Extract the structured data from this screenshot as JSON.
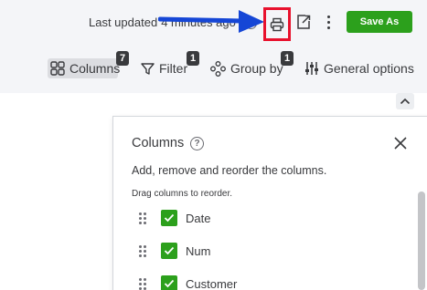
{
  "header": {
    "last_updated_label": "Last updated",
    "last_updated_ago": "4 minutes ago",
    "save_label": "Save As"
  },
  "toolbar": {
    "columns_label": "Columns",
    "columns_count": "7",
    "filter_label": "Filter",
    "filter_count": "1",
    "group_by_label": "Group by",
    "group_by_count": "1",
    "general_options_label": "General options"
  },
  "columns_panel": {
    "title": "Columns",
    "description": "Add, remove and reorder the columns.",
    "hint": "Drag columns to reorder.",
    "items": [
      {
        "label": "Date",
        "checked": true
      },
      {
        "label": "Num",
        "checked": true
      },
      {
        "label": "Customer",
        "checked": true
      }
    ]
  },
  "colors": {
    "accent_green": "#2ca01c",
    "highlight_red": "#e8112d",
    "arrow_blue": "#1546d6"
  }
}
